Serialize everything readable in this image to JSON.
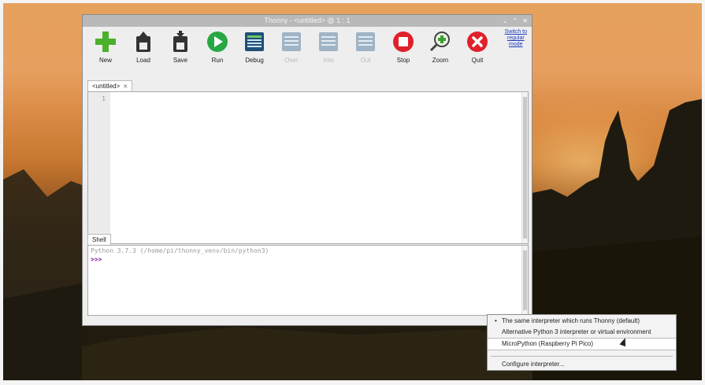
{
  "window": {
    "title": "Thonny  -  <untitled>  @  1 : 1"
  },
  "toolbar": {
    "items": [
      {
        "label": "New",
        "icon": "new-icon",
        "enabled": true
      },
      {
        "label": "Load",
        "icon": "load-icon",
        "enabled": true
      },
      {
        "label": "Save",
        "icon": "save-icon",
        "enabled": true
      },
      {
        "label": "Run",
        "icon": "run-icon",
        "enabled": true
      },
      {
        "label": "Debug",
        "icon": "debug-icon",
        "enabled": true
      },
      {
        "label": "Over",
        "icon": "step-over-icon",
        "enabled": false
      },
      {
        "label": "Into",
        "icon": "step-into-icon",
        "enabled": false
      },
      {
        "label": "Out",
        "icon": "step-out-icon",
        "enabled": false
      },
      {
        "label": "Stop",
        "icon": "stop-icon",
        "enabled": true
      },
      {
        "label": "Zoom",
        "icon": "zoom-icon",
        "enabled": true
      },
      {
        "label": "Quit",
        "icon": "quit-icon",
        "enabled": true
      }
    ],
    "switch_mode_line1": "Switch to",
    "switch_mode_line2": "regular",
    "switch_mode_line3": "mode"
  },
  "editor": {
    "tab_label": "<untitled>",
    "tab_close": "✕",
    "line_number": "1"
  },
  "shell": {
    "tab_label": "Shell",
    "banner": "Python 3.7.3 (/home/pi/thonny_venv/bin/python3)",
    "prompt": ">>>"
  },
  "interpreter_menu": {
    "items": [
      {
        "label": "The same interpreter which runs Thonny (default)",
        "bullet": "•"
      },
      {
        "label": "Alternative Python 3 interpreter or virtual environment"
      },
      {
        "label": "MicroPython (Raspberry Pi Pico)"
      },
      {
        "label": "Configure interpreter..."
      }
    ]
  },
  "colors": {
    "titlebar": "#b9b9b9",
    "new_green": "#4cb02c",
    "run_green": "#27a844",
    "stop_red": "#e0202a",
    "quit_red": "#e0202a",
    "debug_blue": "#1f4f7a",
    "link_blue": "#1a3bbd",
    "prompt_purple": "#7a1d9a"
  }
}
